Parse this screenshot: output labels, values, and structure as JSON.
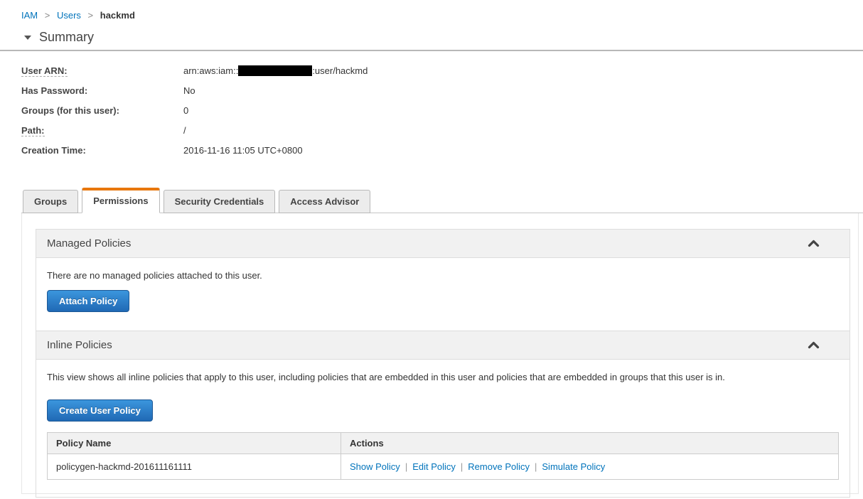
{
  "breadcrumb": {
    "separator": ">",
    "items": [
      {
        "label": "IAM"
      },
      {
        "label": "Users"
      },
      {
        "label": "hackmd"
      }
    ]
  },
  "summary": {
    "title": "Summary",
    "fields": [
      {
        "label": "User ARN:",
        "value_prefix": "arn:aws:iam::",
        "value_suffix": ":user/hackmd",
        "redacted": true
      },
      {
        "label": "Has Password:",
        "value": "No"
      },
      {
        "label": "Groups (for this user):",
        "value": "0"
      },
      {
        "label": "Path:",
        "value": "/"
      },
      {
        "label": "Creation Time:",
        "value": "2016-11-16 11:05 UTC+0800"
      }
    ]
  },
  "tabs": [
    {
      "label": "Groups",
      "active": false
    },
    {
      "label": "Permissions",
      "active": true
    },
    {
      "label": "Security Credentials",
      "active": false
    },
    {
      "label": "Access Advisor",
      "active": false
    }
  ],
  "managed_policies": {
    "title": "Managed Policies",
    "empty_text": "There are no managed policies attached to this user.",
    "attach_button": "Attach Policy"
  },
  "inline_policies": {
    "title": "Inline Policies",
    "description": "This view shows all inline policies that apply to this user, including policies that are embedded in this user and policies that are embedded in groups that this user is in.",
    "create_button": "Create User Policy",
    "table": {
      "headers": [
        "Policy Name",
        "Actions"
      ],
      "actions_separator": "|",
      "rows": [
        {
          "policy_name": "policygen-hackmd-201611161111",
          "actions": [
            "Show Policy",
            "Edit Policy",
            "Remove Policy",
            "Simulate Policy"
          ]
        }
      ]
    }
  },
  "colors": {
    "link_blue": "#0073bb",
    "tab_active_orange": "#e8770d",
    "section_header_bg": "#f1f1f1",
    "button_gradient_top": "#3b96dd",
    "button_gradient_bottom": "#2069b5"
  }
}
